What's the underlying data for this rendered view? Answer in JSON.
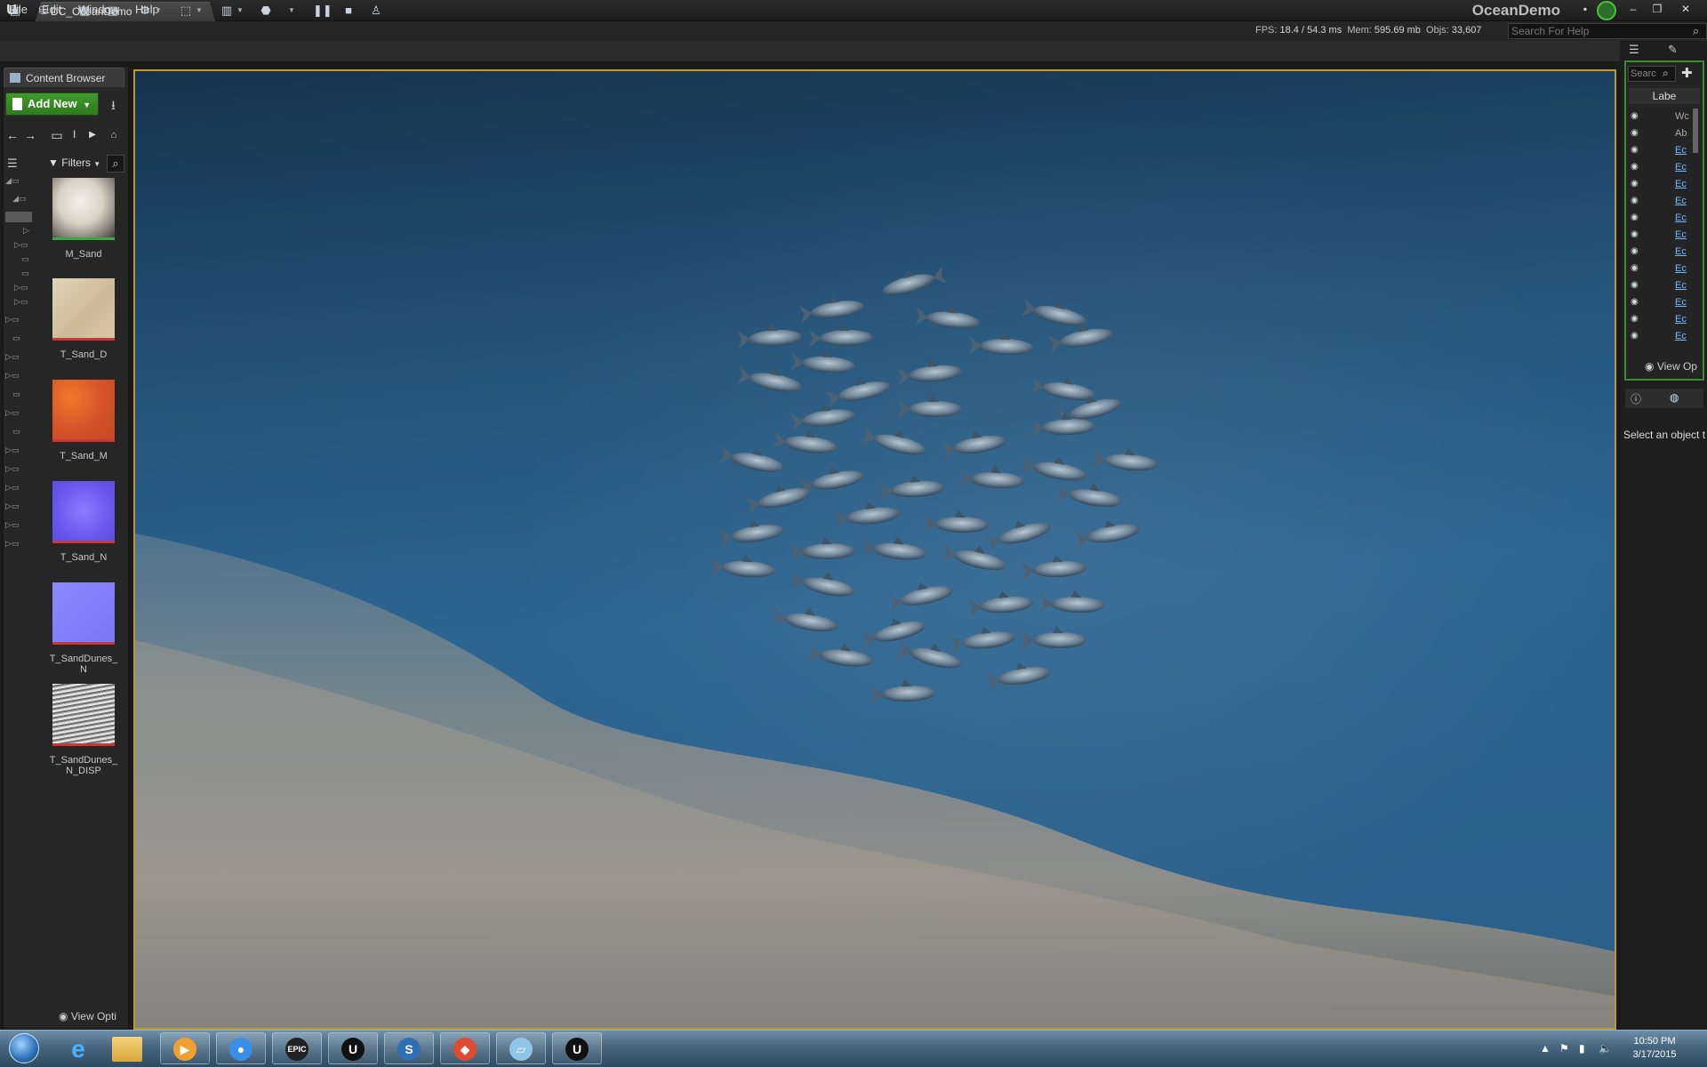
{
  "window": {
    "doc_tab": "DC_OceanDemo",
    "project_name": "OceanDemo",
    "menu": [
      "File",
      "Edit",
      "Window",
      "Help"
    ],
    "search_placeholder": "Search For Help"
  },
  "stats": {
    "fps_label": "FPS:",
    "fps_value": "18.4 / 54.3 ms",
    "mem_label": "Mem:",
    "mem_value": "595.69 mb",
    "objs_label": "Objs:",
    "objs_value": "33,607"
  },
  "toolbar": {
    "icons": [
      "save-icon",
      "source-control-icon",
      "content-icon",
      "marketplace-icon",
      "settings-icon",
      "blueprints-icon",
      "matinee-icon",
      "build-icon",
      "play-icon",
      "pause-icon",
      "stop-icon",
      "eject-icon"
    ]
  },
  "content_browser": {
    "tab_label": "Content Browser",
    "add_new_label": "Add New",
    "path_text": "I",
    "filters_label": "Filters",
    "view_options_label": "View Opti",
    "assets": [
      {
        "name": "M_Sand",
        "kind": "material"
      },
      {
        "name": "T_Sand_D",
        "kind": "texture-diffuse"
      },
      {
        "name": "T_Sand_M",
        "kind": "texture-mask"
      },
      {
        "name": "T_Sand_N",
        "kind": "texture-normal"
      },
      {
        "name": "T_SandDunes_\nN",
        "kind": "texture-normal"
      },
      {
        "name": "T_SandDunes_\nN_DISP",
        "kind": "texture-displacement"
      }
    ]
  },
  "outliner": {
    "search_placeholder": "Searc",
    "label_header": "Labe",
    "rows": [
      "Wc",
      "Ab",
      "Ec",
      "Ec",
      "Ec",
      "Ec",
      "Ec",
      "Ec",
      "Ec",
      "Ec",
      "Ec",
      "Ec",
      "Ec",
      "Ec"
    ],
    "view_options_label": "View Op"
  },
  "details": {
    "empty_message": "Select an object t"
  },
  "taskbar": {
    "apps": [
      "media-player",
      "chrome",
      "epic-games",
      "unreal-engine",
      "sublime",
      "git",
      "notes",
      "unreal-engine-active"
    ],
    "time": "10:50 PM",
    "date": "3/17/2015"
  },
  "colors": {
    "accent_green": "#3f9a2b",
    "viewport_border": "#b69a3a",
    "link_blue": "#6fb7ff"
  }
}
